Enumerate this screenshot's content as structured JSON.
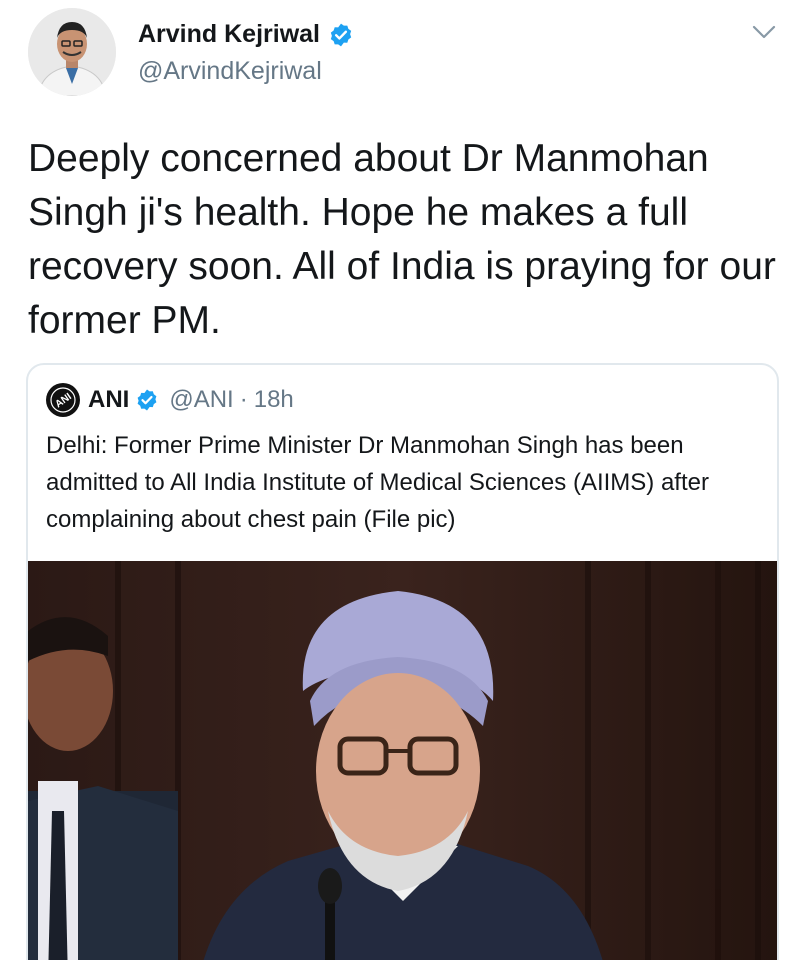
{
  "author": {
    "display_name": "Arvind Kejriwal",
    "handle": "@ArvindKejriwal",
    "verified": true
  },
  "tweet": {
    "text": "Deeply concerned about Dr Manmohan Singh ji's health. Hope he makes a full recovery soon. All of India is praying for our former PM."
  },
  "quoted": {
    "display_name": "ANI",
    "logo_text": "ANI",
    "verified": true,
    "handle": "@ANI",
    "separator": "·",
    "time": "18h",
    "text": "Delhi: Former Prime Minister Dr Manmohan Singh has been admitted to All India Institute of Medical Sciences (AIIMS) after complaining about chest pain (File pic)"
  },
  "icons": {
    "verified": "verified-badge-icon",
    "menu": "chevron-down-icon"
  },
  "colors": {
    "verified_blue": "#1da1f2",
    "secondary_text": "#657786",
    "border": "#e1e8ed"
  }
}
